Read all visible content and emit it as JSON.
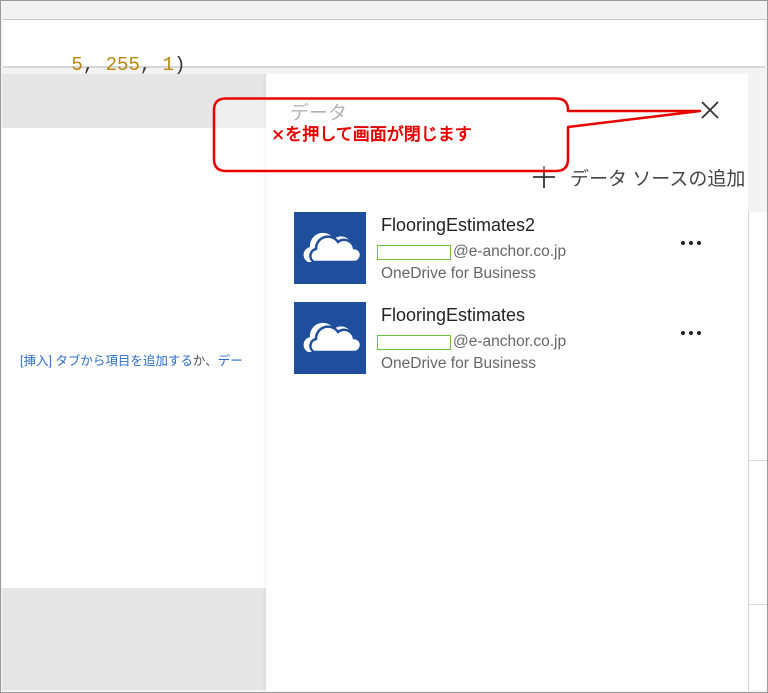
{
  "formula": {
    "segments": [
      {
        "text": "5",
        "kind": "num"
      },
      {
        "text": ", ",
        "kind": "punc"
      },
      {
        "text": "255",
        "kind": "num"
      },
      {
        "text": ", ",
        "kind": "punc"
      },
      {
        "text": "1",
        "kind": "num"
      },
      {
        "text": ")",
        "kind": "punc"
      }
    ]
  },
  "canvas": {
    "hint_link": "[挿入] タブから項目を追加する",
    "hint_plain": "か、",
    "hint_link2": "デー"
  },
  "panel": {
    "title": "データ",
    "add_source_label": "データ ソースの追加",
    "sources": [
      {
        "name": "FlooringEstimates2",
        "account_domain": "@e-anchor.co.jp",
        "service": "OneDrive for Business"
      },
      {
        "name": "FlooringEstimates",
        "account_domain": "@e-anchor.co.jp",
        "service": "OneDrive for Business"
      }
    ]
  },
  "annotation": {
    "text": "×を押して画面が閉じます",
    "color": "#e60000"
  },
  "icons": {
    "close": "close-icon",
    "add": "plus-icon",
    "source_thumb": "onedrive-cloud-icon",
    "more": "ellipsis-icon"
  },
  "colors": {
    "thumb_bg": "#1e4e9c",
    "link": "#2a6cc9",
    "formula_number": "#b8860b",
    "redaction_border": "#6fbf3f"
  }
}
